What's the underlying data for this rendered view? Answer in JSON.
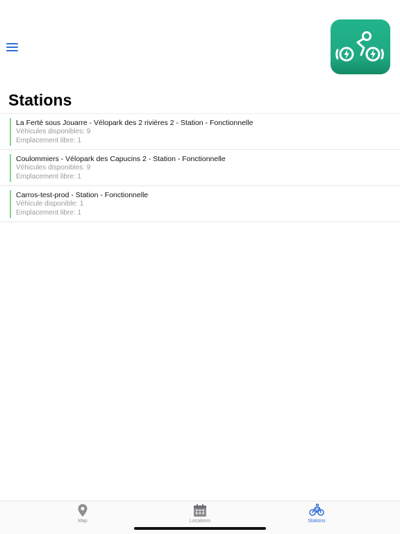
{
  "header": {
    "title": "Stations"
  },
  "stations": [
    {
      "name": "La Ferté sous Jouarre - Vélopark des 2 rivières 2 - Station - Fonctionnelle",
      "vehicles": "Véhicules disponibles: 9",
      "slots": "Emplacement libre: 1"
    },
    {
      "name": "Coulommiers - Vélopark des Capucins 2 - Station - Fonctionnelle",
      "vehicles": "Véhicules disponibles: 9",
      "slots": "Emplacement libre: 1"
    },
    {
      "name": "Carros-test-prod - Station - Fonctionnelle",
      "vehicles": "Véhicule disponible: 1",
      "slots": "Emplacement libre: 1"
    }
  ],
  "tabs": [
    {
      "label": "Map",
      "icon": "map-pin-icon",
      "active": false
    },
    {
      "label": "Locations",
      "icon": "calendar-icon",
      "active": false
    },
    {
      "label": "Stations",
      "icon": "bicycle-icon",
      "active": true
    }
  ],
  "colors": {
    "accent": "#2f6fd6",
    "logo_green": "#22b48c",
    "status_bar": "#7ed491",
    "inactive": "#8e8e93"
  }
}
